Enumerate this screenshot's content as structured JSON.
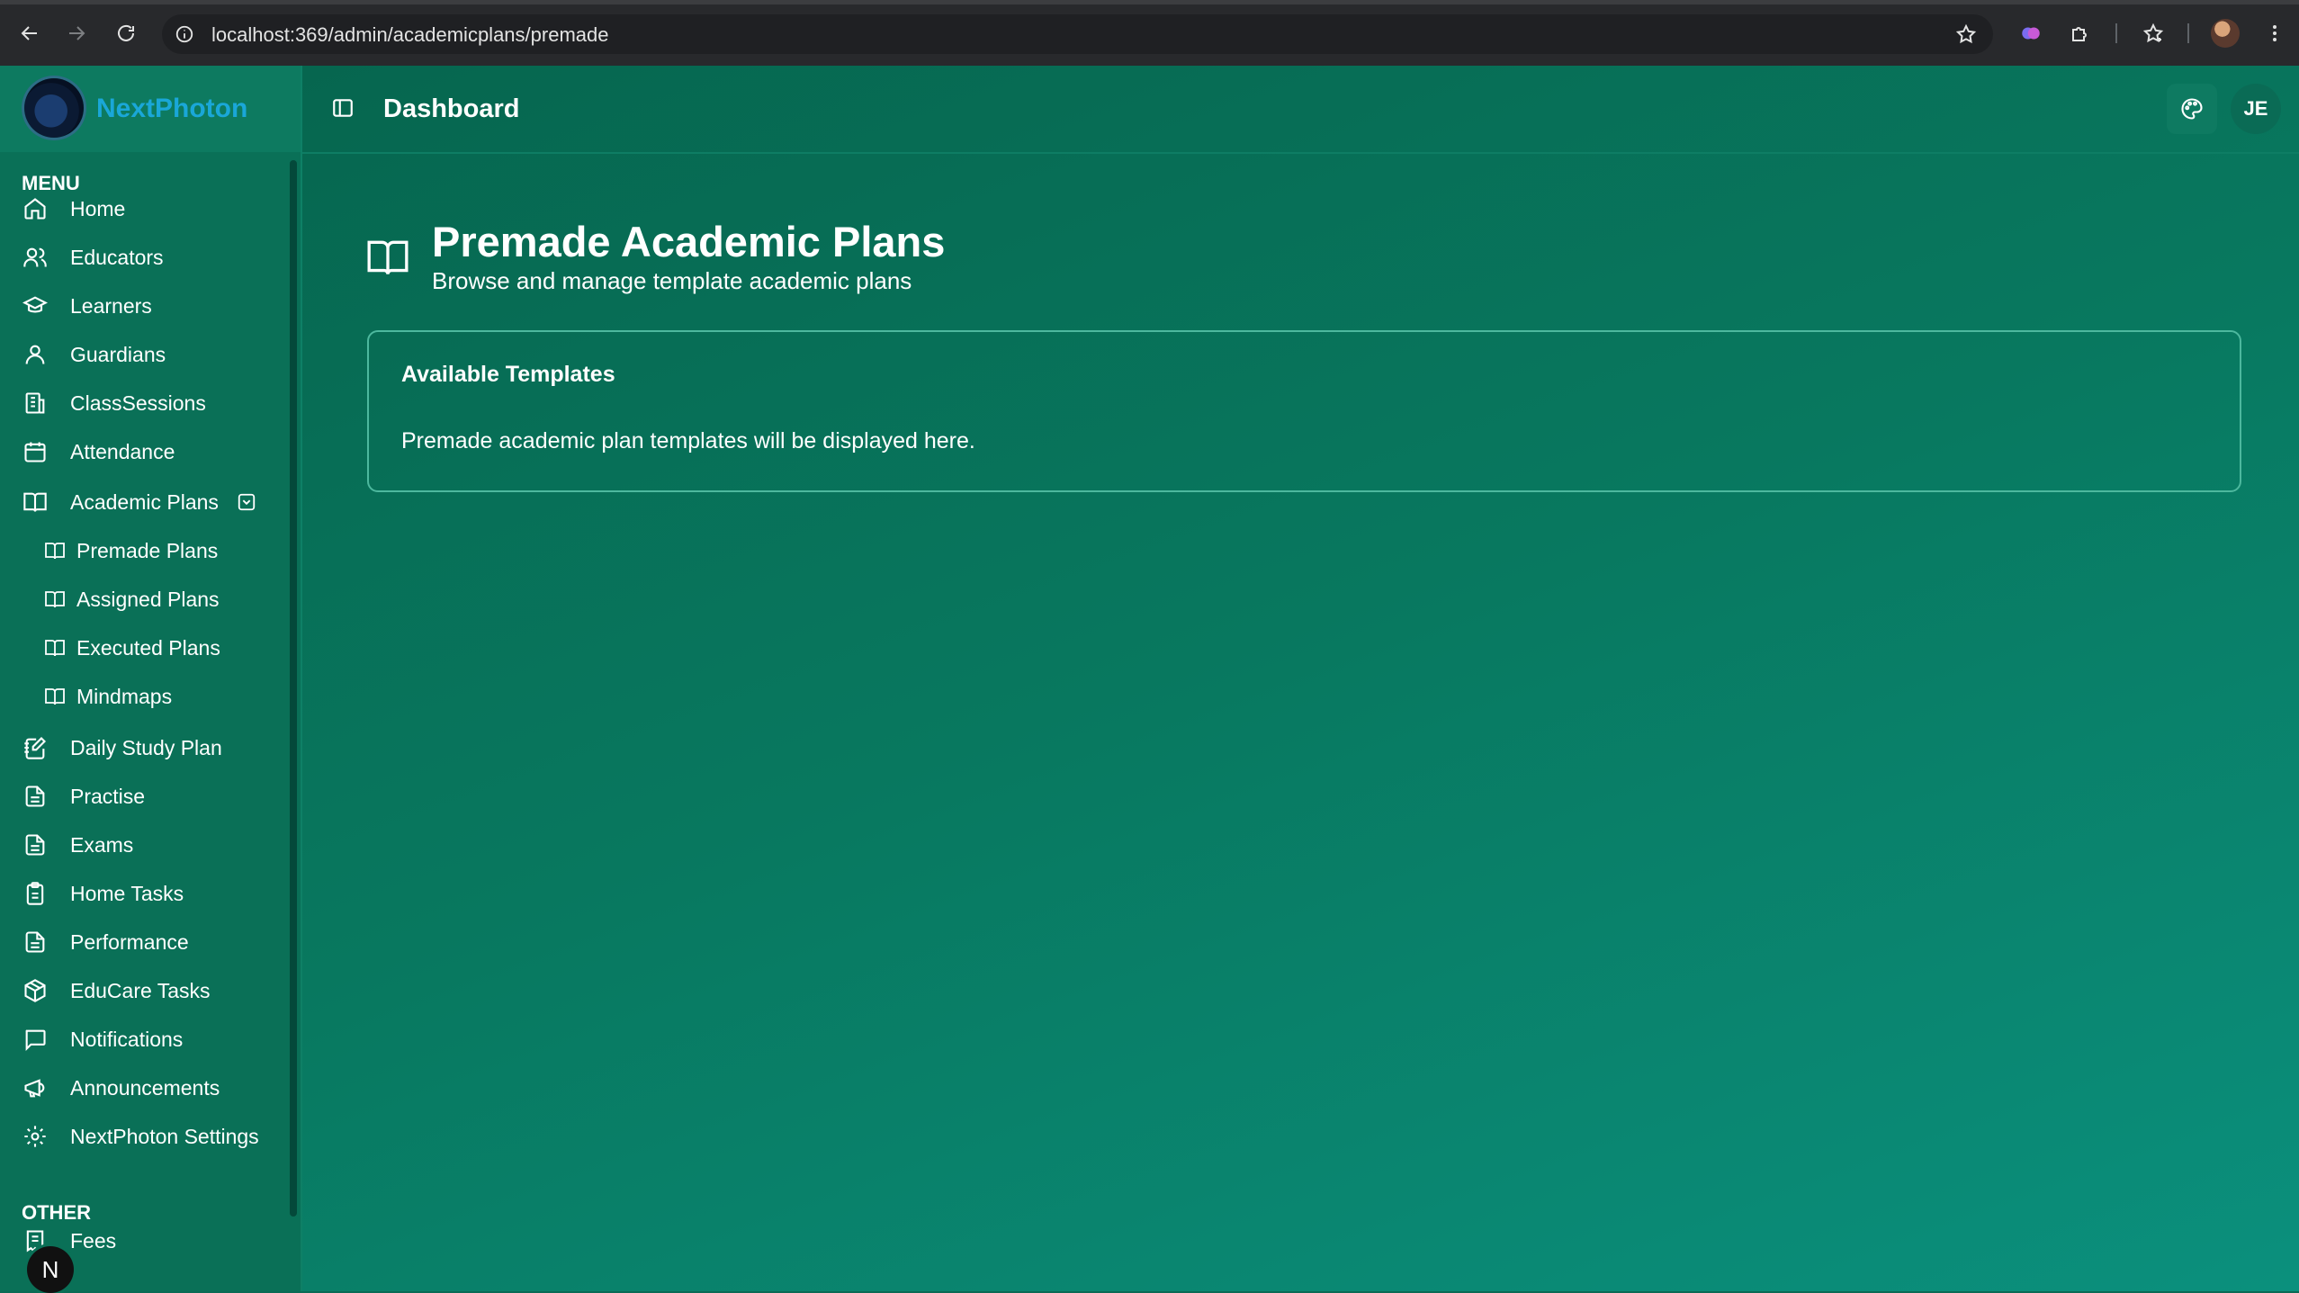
{
  "browser": {
    "url": "localhost:369/admin/academicplans/premade"
  },
  "sidebar": {
    "brand": "NextPhoton",
    "menu_title": "MENU",
    "items": [
      {
        "label": "Home",
        "icon": "home-icon"
      },
      {
        "label": "Educators",
        "icon": "users-icon"
      },
      {
        "label": "Learners",
        "icon": "graduation-cap-icon"
      },
      {
        "label": "Guardians",
        "icon": "user-icon"
      },
      {
        "label": "ClassSessions",
        "icon": "building-icon"
      },
      {
        "label": "Attendance",
        "icon": "calendar-icon"
      },
      {
        "label": "Academic Plans",
        "icon": "book-open-icon"
      }
    ],
    "academic_sub": [
      {
        "label": "Premade Plans"
      },
      {
        "label": "Assigned Plans"
      },
      {
        "label": "Executed Plans"
      },
      {
        "label": "Mindmaps"
      }
    ],
    "items2": [
      {
        "label": "Daily Study Plan",
        "icon": "notebook-pen-icon"
      },
      {
        "label": "Practise",
        "icon": "file-text-icon"
      },
      {
        "label": "Exams",
        "icon": "file-text-icon"
      },
      {
        "label": "Home Tasks",
        "icon": "clipboard-icon"
      },
      {
        "label": "Performance",
        "icon": "file-text-icon"
      },
      {
        "label": "EduCare Tasks",
        "icon": "package-icon"
      },
      {
        "label": "Notifications",
        "icon": "message-square-icon"
      },
      {
        "label": "Announcements",
        "icon": "megaphone-icon"
      },
      {
        "label": "NextPhoton Settings",
        "icon": "gear-icon"
      }
    ],
    "other_title": "OTHER",
    "other_items": [
      {
        "label": "Fees",
        "icon": "receipt-icon"
      }
    ],
    "fab_letter": "N"
  },
  "header": {
    "title": "Dashboard",
    "avatar_initials": "JE"
  },
  "main": {
    "title": "Premade Academic Plans",
    "subtitle": "Browse and manage template academic plans",
    "card": {
      "title": "Available Templates",
      "body": "Premade academic plan templates will be displayed here."
    }
  },
  "colors": {
    "accent": "#1aa7d8",
    "background": "#08785f"
  }
}
